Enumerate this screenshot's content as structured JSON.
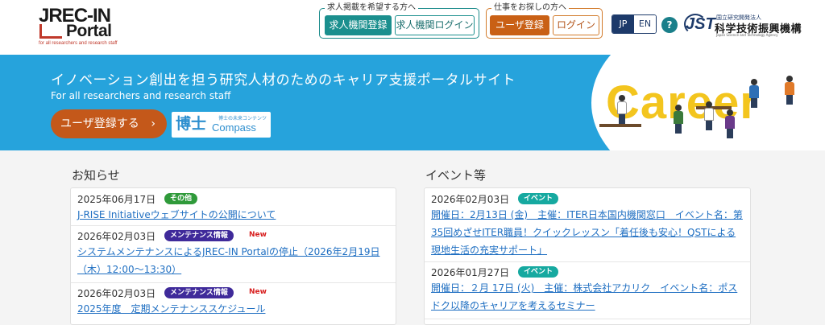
{
  "header": {
    "logo": {
      "main": "JREC-IN",
      "sub": "Portal",
      "tagline": "for all researchers and research staff"
    },
    "orgs": {
      "title": "求人掲載を希望する方へ",
      "register": "求人機関登録",
      "login": "求人機関ログイン"
    },
    "users": {
      "title": "仕事をお探しの方へ",
      "register": "ユーザ登録",
      "login": "ログイン"
    },
    "lang": {
      "jp": "JP",
      "en": "EN"
    },
    "help": "?",
    "jst": {
      "mark": "JST",
      "small": "国立研究開発法人",
      "name": "科学技術振興機構",
      "en": "Japan Science and Technology Agency"
    }
  },
  "banner": {
    "title": "イノベーション創出を担う研究人材のためのキャリア支援ポータルサイト",
    "subtitle": "For all researchers and research staff",
    "register_button": "ユーザ登録する",
    "register_chevron": "›",
    "compass": {
      "kanji": "博士",
      "small": "博士の未来コンテンツ",
      "word": "Compass"
    },
    "art_word": "Career"
  },
  "news": {
    "title": "お知らせ",
    "items": [
      {
        "date": "2025年06月17日",
        "badge": "その他",
        "new": "",
        "text": "J-RISE Initiativeウェブサイトの公開について"
      },
      {
        "date": "2026年02月03日",
        "badge": "メンテナンス情報",
        "new": "New",
        "text": "システムメンテナンスによるJREC-IN Portalの停止（2026年2月19日（木）12:00～13:30）"
      },
      {
        "date": "2026年02月03日",
        "badge": "メンテナンス情報",
        "new": "New",
        "text": "2025年度　定期メンテナンススケジュール"
      }
    ]
  },
  "events": {
    "title": "イベント等",
    "items": [
      {
        "date": "2026年02月03日",
        "badge": "イベント",
        "text": "開催日：2月13日 (金)　主催：ITER日本国内機関窓口　イベント名：第35回めざせITER職員！クイックレッスン「着任後も安心！QSTによる現地生活の充実サポート」"
      },
      {
        "date": "2026年01月27日",
        "badge": "イベント",
        "text": "開催日：２月 17日 (火)　主催：株式会社アカリク　イベント名：ポスドク以降のキャリアを考えるセミナー"
      }
    ]
  },
  "colors": {
    "banner": "#26a3dc",
    "teal": "#1b8f8e",
    "orange": "#c96015",
    "navy": "#1d3a6a",
    "link": "#1f6fc2"
  }
}
